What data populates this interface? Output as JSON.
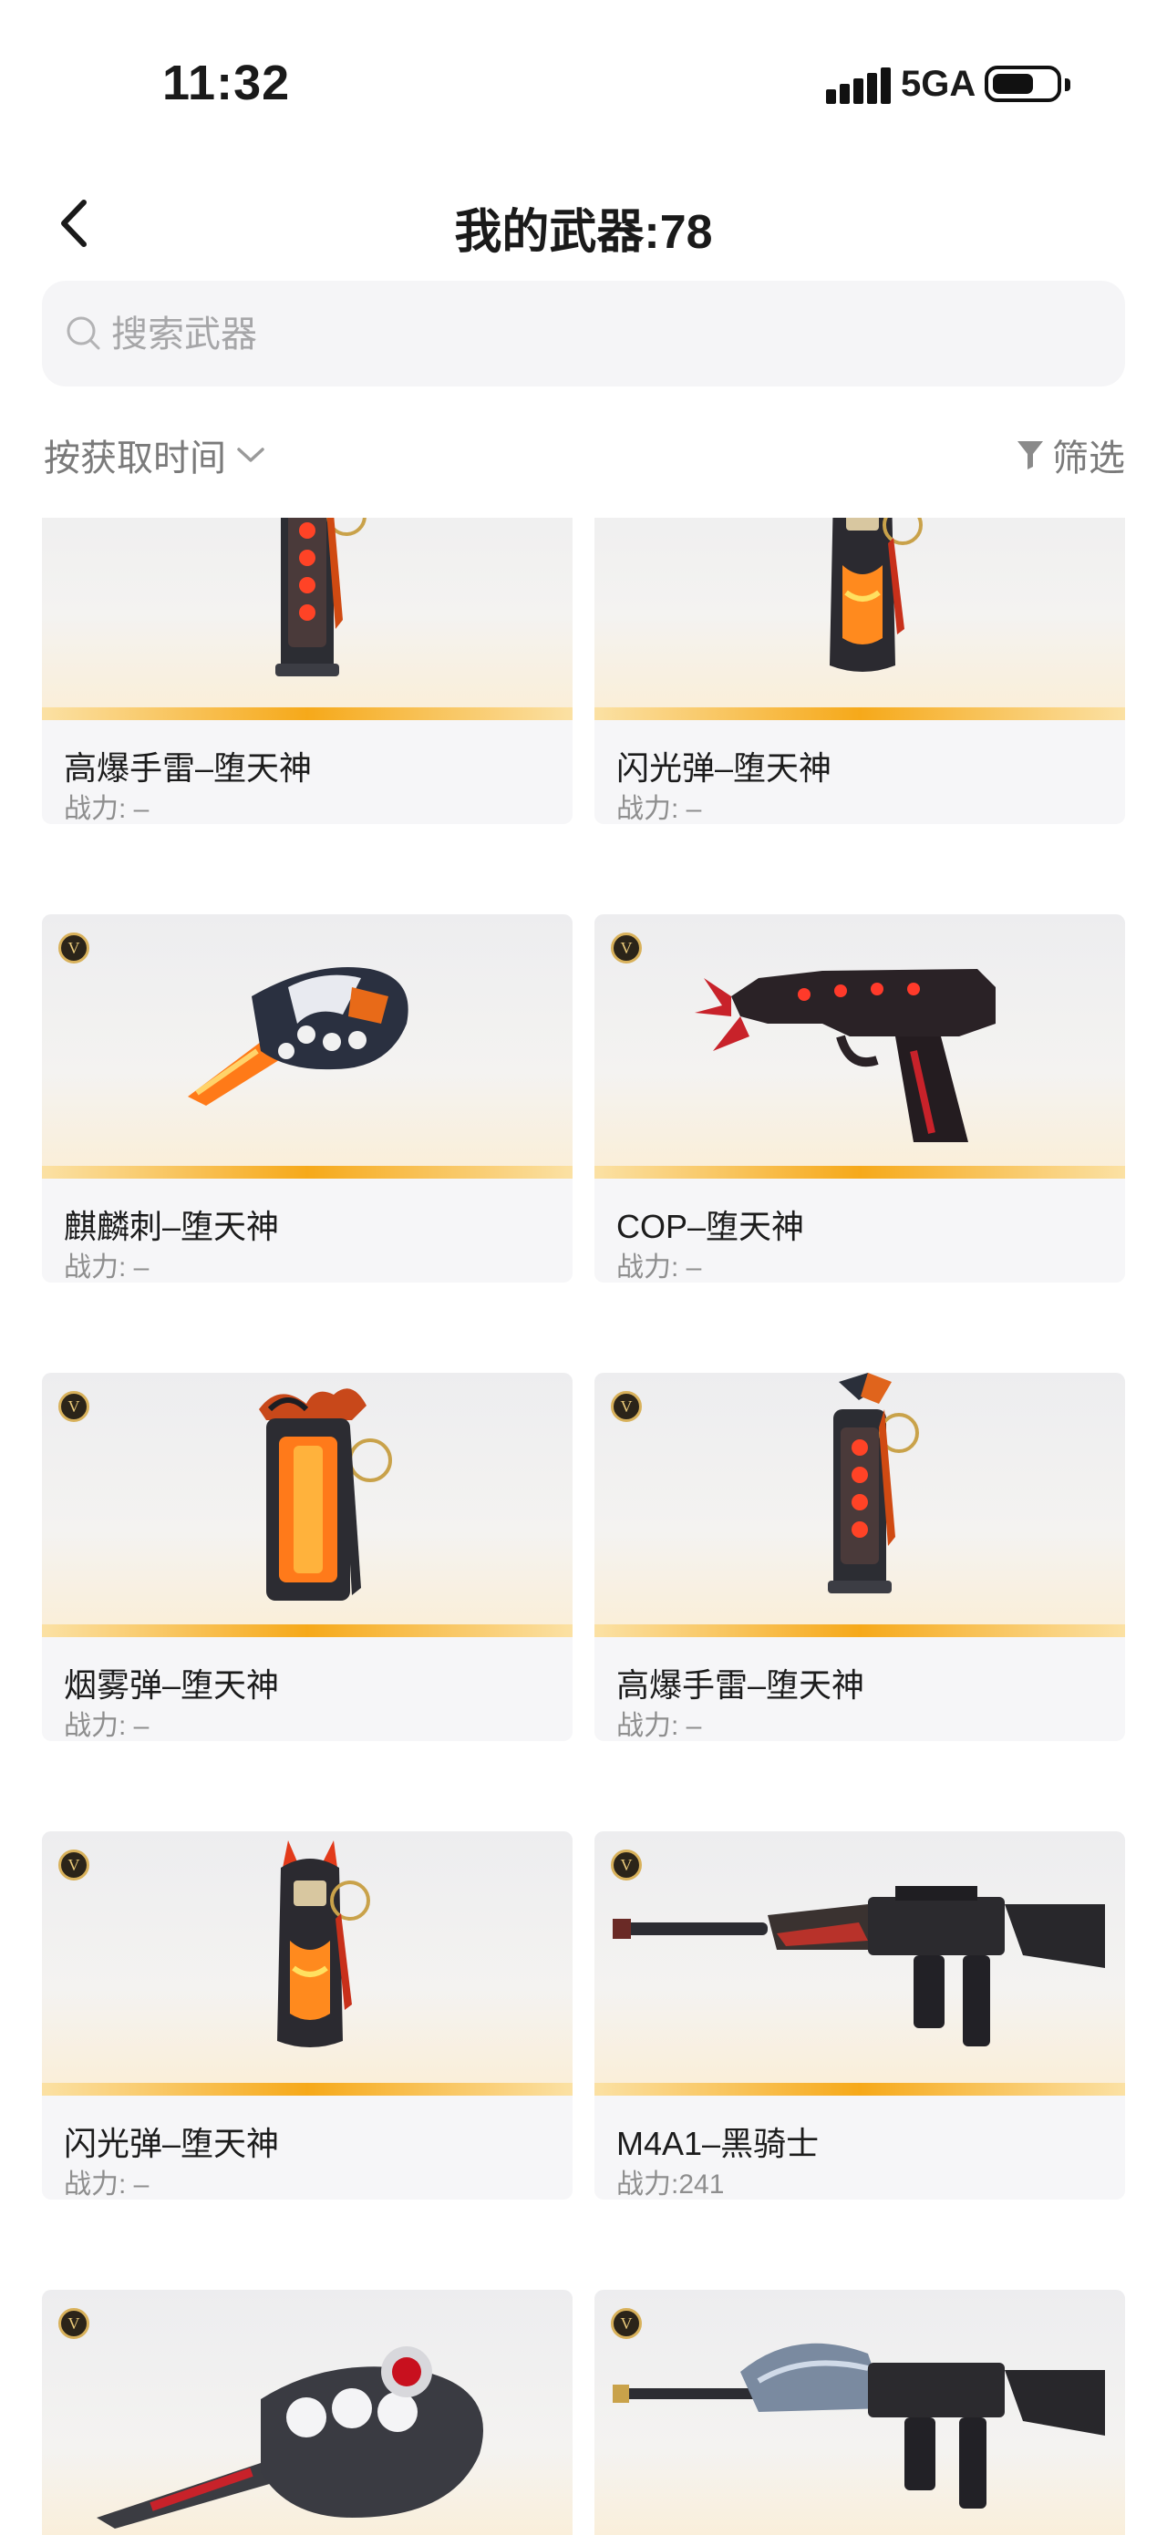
{
  "status": {
    "time": "11:32",
    "network": "5GA"
  },
  "nav": {
    "title": "我的武器:78",
    "back_icon": "chevron-left-icon"
  },
  "search": {
    "placeholder": "搜索武器",
    "icon": "search-icon"
  },
  "sort": {
    "label": "按获取时间",
    "icon": "chevron-down-icon"
  },
  "filter": {
    "label": "筛选",
    "icon": "funnel-icon"
  },
  "badge_letter": "V",
  "accent": "#f6a91a",
  "items": [
    {
      "name": "高爆手雷–堕天神",
      "power": "战力: –",
      "art": "grenade"
    },
    {
      "name": "闪光弹–堕天神",
      "power": "战力: –",
      "art": "flash"
    },
    {
      "name": "麒麟刺–堕天神",
      "power": "战力: –",
      "art": "knife"
    },
    {
      "name": "COP–堕天神",
      "power": "战力: –",
      "art": "pistol"
    },
    {
      "name": "烟雾弹–堕天神",
      "power": "战力: –",
      "art": "smoke"
    },
    {
      "name": "高爆手雷–堕天神",
      "power": "战力: –",
      "art": "grenade"
    },
    {
      "name": "闪光弹–堕天神",
      "power": "战力: –",
      "art": "flash"
    },
    {
      "name": "M4A1–黑骑士",
      "power": "战力:241",
      "art": "rifle"
    },
    {
      "name": "",
      "power": "",
      "art": "knuckle"
    },
    {
      "name": "",
      "power": "",
      "art": "rifle2"
    }
  ]
}
